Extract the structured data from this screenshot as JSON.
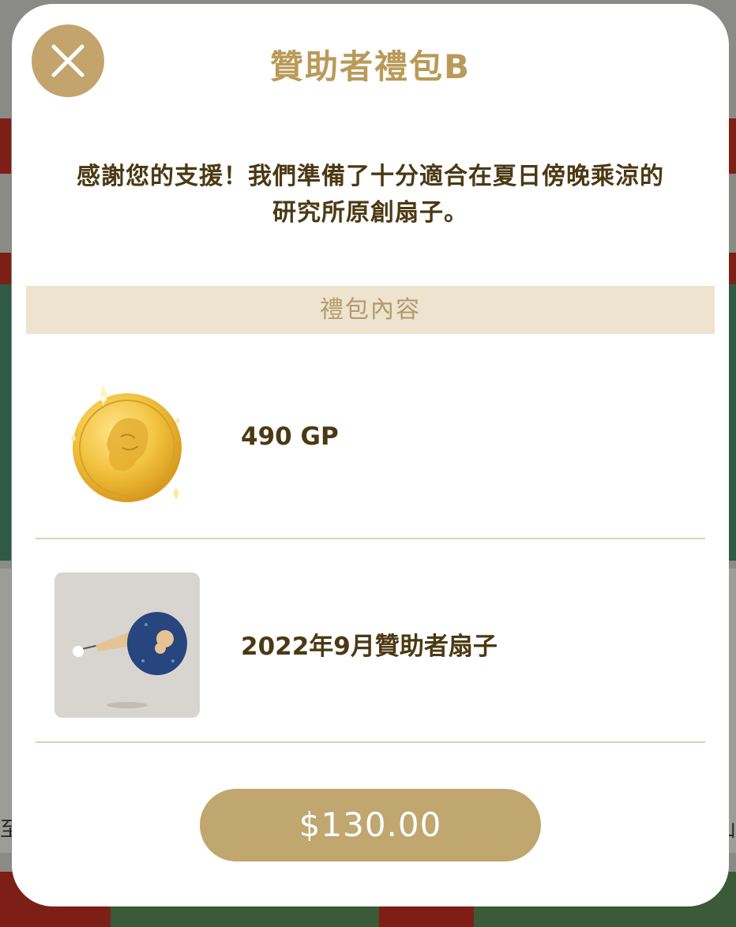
{
  "modal": {
    "title": "贊助者禮包B",
    "description_line1": "感謝您的支援！我們準備了十分適合在夏日傍晚乘涼的",
    "description_line2": "研究所原創扇子。",
    "section_header": "禮包內容",
    "items": [
      {
        "label": "490 GP",
        "icon": "gold-coin-icon"
      },
      {
        "label": "2022年9月贊助者扇子",
        "icon": "fan-icon"
      }
    ],
    "price_label": "$130.00",
    "close_icon": "close-icon"
  },
  "background": {
    "edge_text_left": "至",
    "edge_text_right": "山"
  },
  "colors": {
    "accent": "#c0a66f",
    "title": "#b99a58",
    "text": "#4b3914",
    "section_bg": "#ede3cf"
  }
}
